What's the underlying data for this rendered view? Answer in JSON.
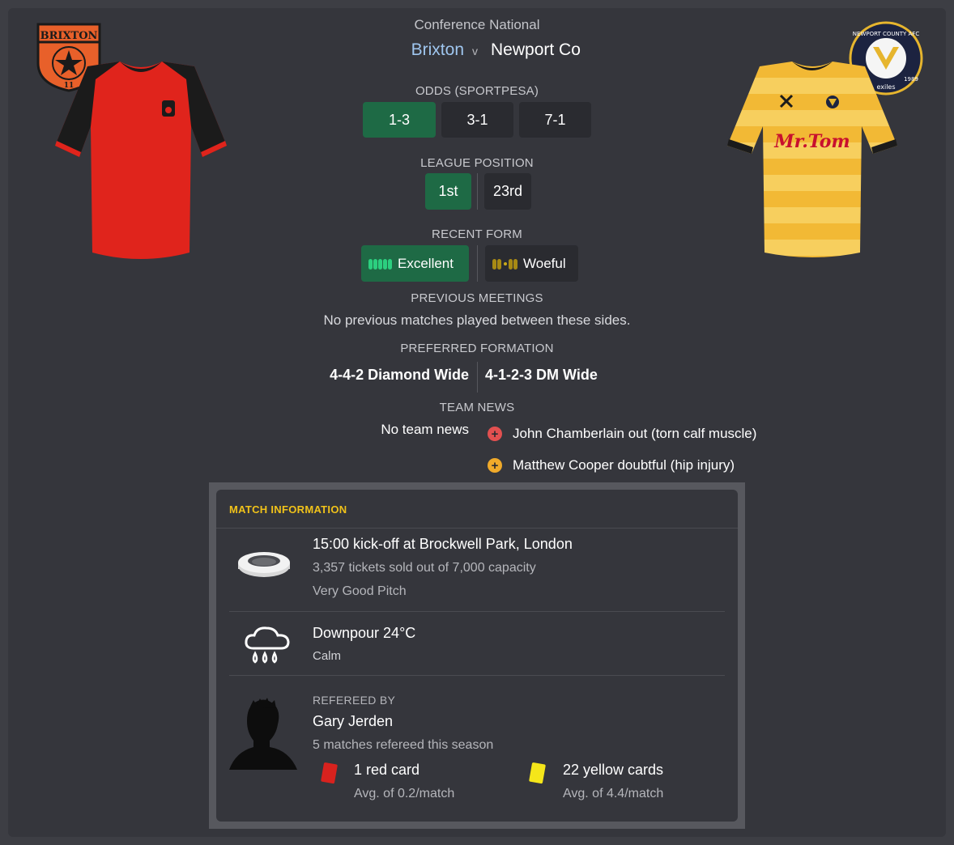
{
  "header": {
    "competition": "Conference National",
    "home_team": "Brixton",
    "versus": "v",
    "away_team": "Newport Co"
  },
  "colors": {
    "panel_bg": "#35363c",
    "box_bg": "#2a2b30",
    "green_highlight": "#1e6a45",
    "home_team_text": "#9fc6ef",
    "accent_yellow": "#f0c21a",
    "injury_red": "#e25050",
    "injury_amber": "#f0aa2a"
  },
  "odds": {
    "label": "ODDS (SPORTPESA)",
    "home": "1-3",
    "draw": "3-1",
    "away": "7-1"
  },
  "league_position": {
    "label": "LEAGUE POSITION",
    "home": "1st",
    "away": "23rd"
  },
  "recent_form": {
    "label": "RECENT FORM",
    "home": "Excellent",
    "away": "Woeful"
  },
  "previous_meetings": {
    "label": "PREVIOUS MEETINGS",
    "text": "No previous matches played between these sides."
  },
  "preferred_formation": {
    "label": "PREFERRED FORMATION",
    "home": "4-4-2 Diamond Wide",
    "away": "4-1-2-3 DM Wide"
  },
  "team_news": {
    "label": "TEAM NEWS",
    "home": "No team news",
    "away": [
      {
        "icon": "injury-out-icon",
        "text": "John Chamberlain out (torn calf muscle)"
      },
      {
        "icon": "injury-doubtful-icon",
        "text": "Matthew Cooper doubtful (hip injury)"
      }
    ]
  },
  "match_information": {
    "title": "MATCH INFORMATION",
    "venue": {
      "icon": "stadium-icon",
      "main": "15:00 kick-off at Brockwell Park, London",
      "tickets": "3,357 tickets sold out of 7,000 capacity",
      "pitch": "Very Good Pitch"
    },
    "weather": {
      "icon": "rain-cloud-icon",
      "main": "Downpour 24°C",
      "wind": "Calm"
    },
    "referee": {
      "icon": "referee-silhouette-icon",
      "label": "REFEREED BY",
      "name": "Gary Jerden",
      "matches": "5 matches refereed this season",
      "red_cards": "1 red card",
      "red_avg": "Avg. of 0.2/match",
      "yellow_cards": "22 yellow cards",
      "yellow_avg": "Avg. of 4.4/match"
    }
  },
  "badges": {
    "home_badge_text": "BRIXTON",
    "home_badge_number": "11",
    "away_badge_text_top": "NEWPORT COUNTY AFC",
    "away_badge_text_bottom": "exiles",
    "away_badge_year_left": "1912",
    "away_badge_year_right": "1989",
    "away_kit_sponsor": "Mr.Tom"
  },
  "form_pips": {
    "home": [
      "W",
      "W",
      "W",
      "W",
      "W"
    ],
    "away": [
      "L",
      "L",
      "D",
      "L",
      "L"
    ]
  }
}
